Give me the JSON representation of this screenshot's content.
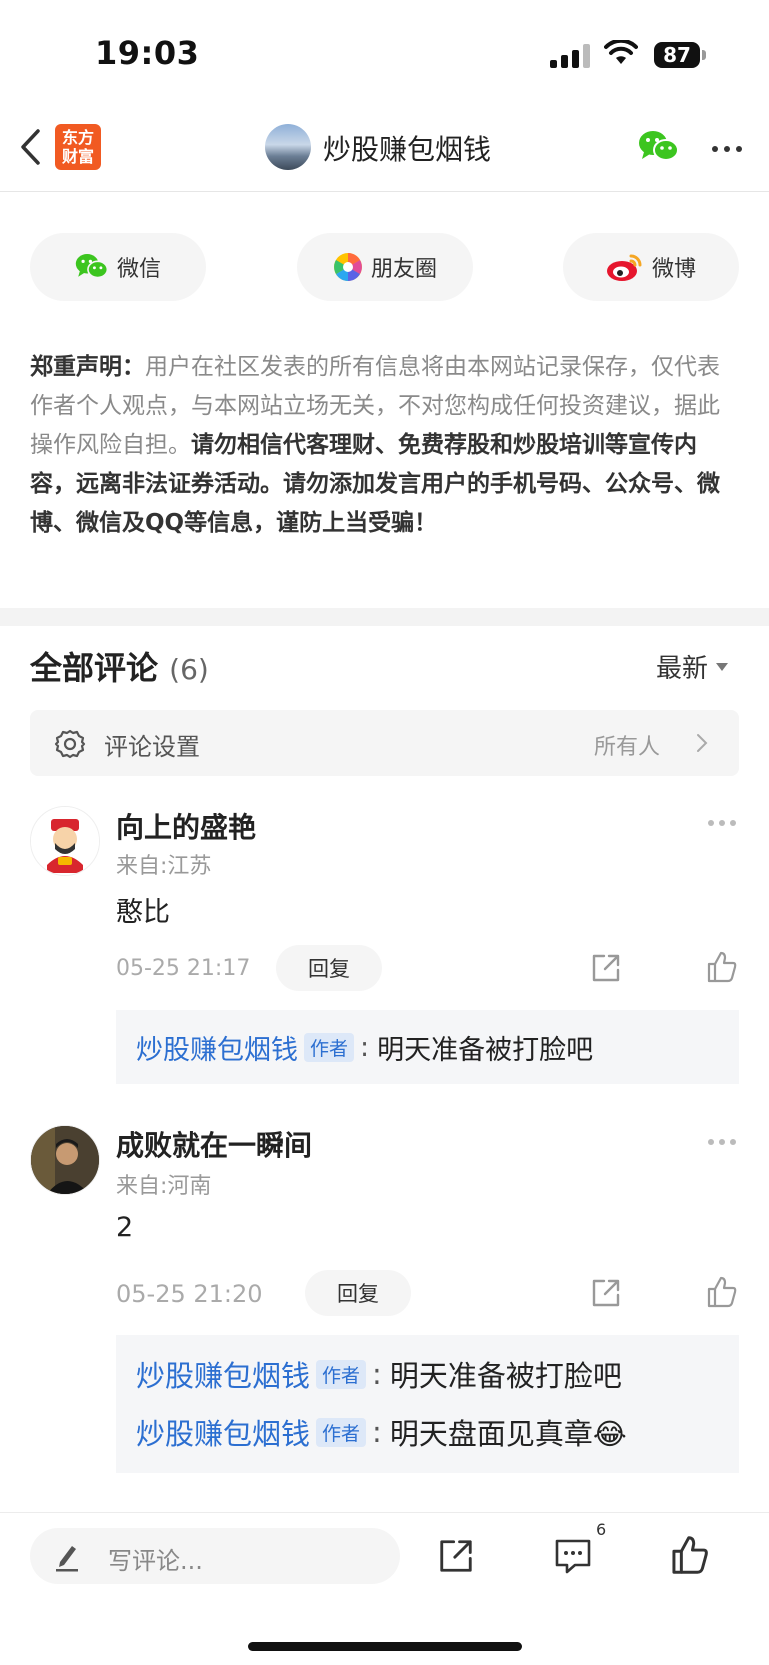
{
  "status_bar": {
    "time": "19:03",
    "battery": "87"
  },
  "nav": {
    "logo_line1": "东方",
    "logo_line2": "财富",
    "title": "炒股赚包烟钱"
  },
  "share": {
    "wechat": "微信",
    "moments": "朋友圈",
    "weibo": "微博"
  },
  "disclaimer": {
    "label": "郑重声明：",
    "normal": "用户在社区发表的所有信息将由本网站记录保存，仅代表作者个人观点，与本网站立场无关，不对您构成任何投资建议，据此操作风险自担。",
    "bold": "请勿相信代客理财、免费荐股和炒股培训等宣传内容，远离非法证券活动。请勿添加发言用户的手机号码、公众号、微博、微信及QQ等信息，谨防上当受骗！"
  },
  "comments_header": {
    "title": "全部评论",
    "count": "(6)",
    "sort": "最新"
  },
  "comment_settings": {
    "label": "评论设置",
    "value": "所有人"
  },
  "comments": [
    {
      "username": "向上的盛艳",
      "location": "来自:江苏",
      "text": "憨比",
      "time": "05-25 21:17",
      "reply": "回复",
      "replies": [
        {
          "name": "炒股赚包烟钱",
          "badge": "作者",
          "colon": ":",
          "text": "明天准备被打脸吧"
        }
      ]
    },
    {
      "username": "成败就在一瞬间",
      "location": "来自:河南",
      "text": "2",
      "time": "05-25 21:20",
      "reply": "回复",
      "replies": [
        {
          "name": "炒股赚包烟钱",
          "badge": "作者",
          "colon": ":",
          "text": "明天准备被打脸吧"
        },
        {
          "name": "炒股赚包烟钱",
          "badge": "作者",
          "colon": ":",
          "text": "明天盘面见真章😂"
        }
      ]
    }
  ],
  "bottom_bar": {
    "placeholder": "写评论...",
    "comment_count": "6"
  }
}
